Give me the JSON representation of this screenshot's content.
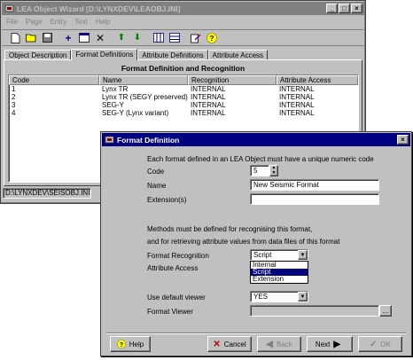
{
  "main_window": {
    "title": "LEA Object Wizard [D:\\LYNXDEV\\LEAOBJ.INI]",
    "window_buttons": [
      "_",
      "□",
      "×"
    ],
    "menu": [
      "File",
      "Page",
      "Entry",
      "Text",
      "Help"
    ],
    "toolbar_icons": [
      "new-icon",
      "open-icon",
      "save-icon",
      "add-icon",
      "properties-icon",
      "delete-icon",
      "move-up-icon",
      "move-down-icon",
      "columns-icon",
      "rows-icon",
      "edit-icon",
      "help-icon"
    ],
    "tabs": [
      "Object Description",
      "Format Definitions",
      "Attribute Definitions",
      "Attribute Access"
    ],
    "selected_tab": "Format Definitions",
    "panel_title": "Format Definition and Recognition",
    "table": {
      "columns": [
        "Code",
        "Name",
        "Recognition",
        "Attribute Access"
      ],
      "rows": [
        [
          "1",
          "Lynx TR",
          "INTERNAL",
          "INTERNAL"
        ],
        [
          "2",
          "Lynx TR (SEGY preserved)",
          "INTERNAL",
          "INTERNAL"
        ],
        [
          "3",
          "SEG-Y",
          "INTERNAL",
          "INTERNAL"
        ],
        [
          "4",
          "SEG-Y (Lynx variant)",
          "INTERNAL",
          "INTERNAL"
        ]
      ]
    },
    "status_path": "D:\\LYNXDEV\\SEISOBJ.INI"
  },
  "dialog": {
    "title": "Format Definition",
    "close_label": "×",
    "intro": "Each format defined in an LEA Object must have a unique numeric code",
    "code_label": "Code",
    "code_value": "5",
    "name_label": "Name",
    "name_value": "New Seismic Format",
    "extensions_label": "Extension(s)",
    "extensions_value": "",
    "methods_line1": "Methods must be defined for recognising this format,",
    "methods_line2": "and for retrieving attribute values from data files of this format",
    "recognition_label": "Format Recognition",
    "recognition_value": "Script",
    "recognition_options": [
      "Internal",
      "Script",
      "Extension"
    ],
    "recognition_selected_index": 1,
    "attribute_access_label": "Attribute Access",
    "default_viewer_label": "Use default viewer",
    "default_viewer_value": "YES",
    "format_viewer_label": "Format Viewer",
    "format_viewer_value": "",
    "browse_label": "...",
    "buttons": {
      "help": "Help",
      "cancel": "Cancel",
      "back": "Back",
      "next": "Next",
      "ok": "OK"
    }
  },
  "colors": {
    "title_active": "#000080",
    "title_inactive": "#808080",
    "face": "#c0c0c0",
    "selection": "#000080"
  }
}
